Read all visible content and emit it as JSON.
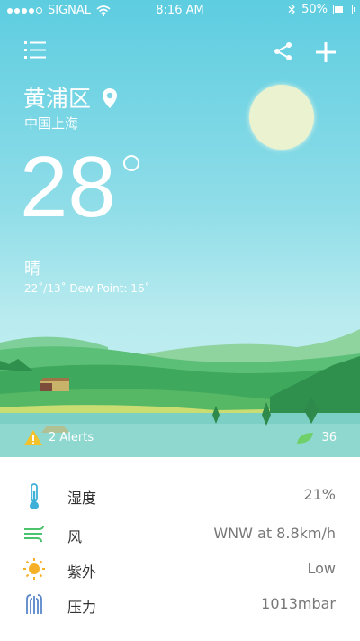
{
  "status_bar": {
    "carrier": "SIGNAL",
    "time": "8:16 AM",
    "battery": "50%",
    "battery_level": 0.5
  },
  "location": {
    "district": "黄浦区",
    "region": "中国上海"
  },
  "current": {
    "temperature": "28",
    "condition": "晴",
    "range": "22˚/13˚   Dew Point: 16˚"
  },
  "footer": {
    "alerts": "2 Alerts",
    "aqi": "36"
  },
  "details": [
    {
      "icon": "thermometer-icon",
      "label": "湿度",
      "value": "21%"
    },
    {
      "icon": "wind-icon",
      "label": "风",
      "value": "WNW at 8.8km/h"
    },
    {
      "icon": "sun-icon",
      "label": "紫外",
      "value": "Low"
    },
    {
      "icon": "pressure-icon",
      "label": "压力",
      "value": "1013mbar"
    }
  ],
  "colors": {
    "sky_top": "#5dcde0",
    "thermometer": "#3fb0d8",
    "wind": "#4cc36e",
    "uv": "#f5b028",
    "pressure": "#5a86c8",
    "alert": "#f3c12a"
  }
}
